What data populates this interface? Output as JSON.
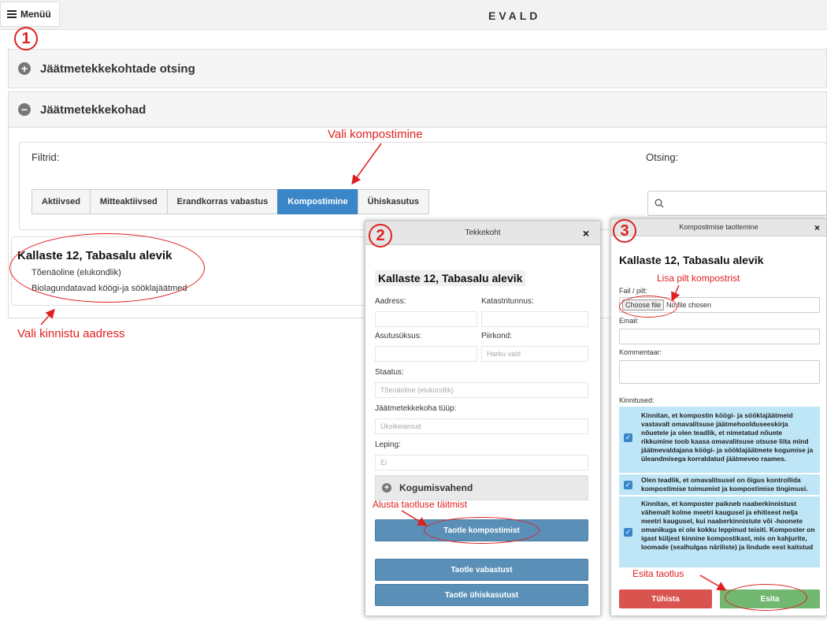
{
  "topbar": {
    "menu_label": "Menüü",
    "brand": "EVALD"
  },
  "search_panel": {
    "title": "Jäätmetekkekohtade otsing",
    "icon": "plus-circle-icon"
  },
  "list_panel": {
    "title": "Jäätmetekkekohad",
    "icon": "minus-circle-icon",
    "filters_label": "Filtrid:",
    "search_label": "Otsing:",
    "filter_buttons": [
      "Aktiivsed",
      "Mitteaktiivsed",
      "Erandkorras vabastus",
      "Kompostimine",
      "Ühiskasutus"
    ],
    "active_filter": "Kompostimine",
    "result": {
      "address": "Kallaste 12, Tabasalu alevik",
      "status": "Tõenäoline (elukondlik)",
      "waste_type": "Biolagundatavad köögi-ja sööklajäätmed"
    }
  },
  "modal_tekkekoht": {
    "title": "Tekkekoht",
    "close": "×",
    "address": "Kallaste 12, Tabasalu alevik",
    "fields": {
      "aadress_label": "Aadress:",
      "katastritunnus_label": "Katastritunnus:",
      "asutusuksus_label": "Asutusüksus:",
      "piirkond_label": "Piirkond:",
      "piirkond_value": "Harku vald",
      "staatus_label": "Staatus:",
      "staatus_value": "Tõenäoline (elukondlik)",
      "tyyp_label": "Jäätmetekkekoha tüüp:",
      "tyyp_value": "Üksikelamud",
      "leping_label": "Leping:",
      "leping_value": "Ei"
    },
    "collapse_label": "Kogumisvahend",
    "buttons": [
      "Taotle kompostimist",
      "Taotle vabastust",
      "Taotle ühiskasutust"
    ]
  },
  "modal_kompost": {
    "title": "Kompostimise taotlemine",
    "close": "×",
    "address": "Kallaste 12, Tabasalu alevik",
    "file_label": "Fail / pilt:",
    "choose_file": "Choose file",
    "no_file": "No file chosen",
    "email_label": "Email:",
    "comment_label": "Kommentaar:",
    "confirmations_label": "Kinnitused:",
    "confirmations": [
      "Kinnitan, et kompostin köögi- ja sööklajäätmeid vastavalt omavalitsuse jäätmehoolduseeskirja nõuetele ja olen teadlik, et nimetatud nõuete rikkumine toob kaasa omavalitsuse otsuse liita mind jäätmevaldajana köögi- ja sööklajäätmete kogumise ja üleandmisega korraldatud jäätmeveo raames.",
      "Olen teadlik, et omavalitsusel on õigus kontrollida kompostimise toimumist ja kompostimise tingimusi.",
      "Kinnitan, et komposter paikneb naaberkinnistust vähemalt kolme meetri kaugusel ja ehitisest nelja meetri kaugusel, kui naaberkinnistute või -hoonete omanikuga ei ole kokku leppinud teisiti. Komposter on igast küljest kinnine kompostikast, mis on kahjurite, loomade (sealhulgas näriliste) ja lindude eest kaitstud"
    ],
    "cancel_label": "Tühista",
    "submit_label": "Esita"
  },
  "annotations": {
    "step1": "1",
    "step2": "2",
    "step3": "3",
    "vali_kompostimine": "Vali kompostimine",
    "vali_aadress": "Vali kinnistu aadress",
    "alusta": "Alusta taotluse täitmist",
    "lisa_pilt": "Lisa pilt kompostrist",
    "esita": "Esita taotlus",
    "color": "#e02020"
  }
}
